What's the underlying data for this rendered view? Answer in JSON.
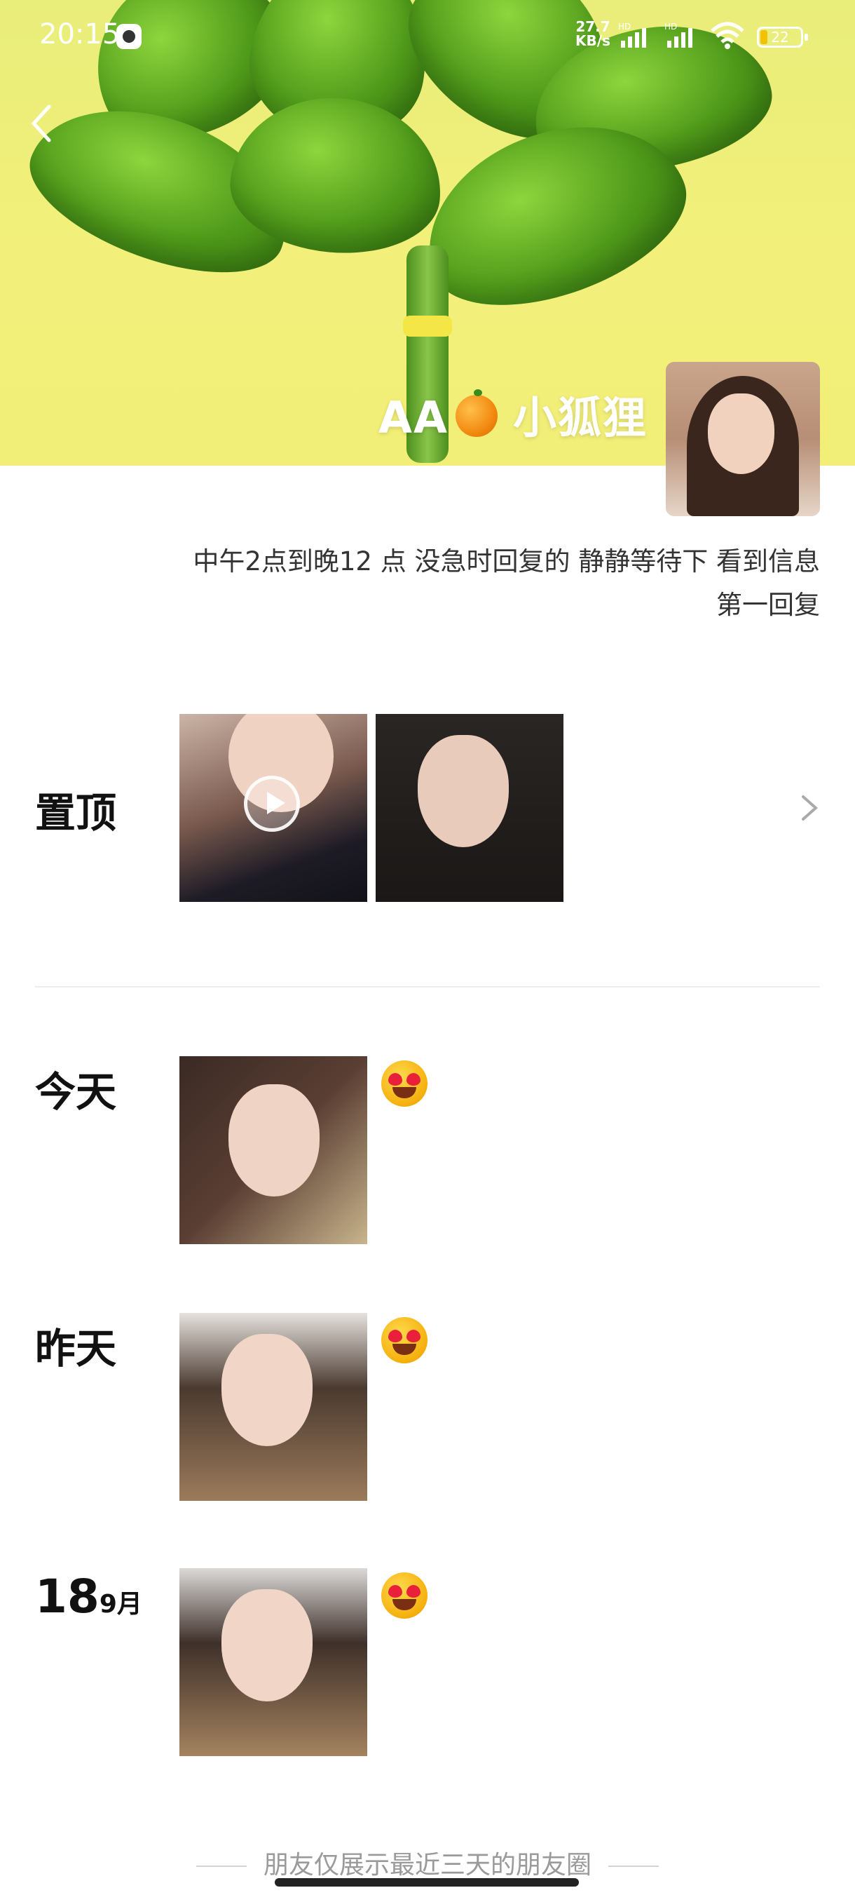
{
  "status_bar": {
    "time": "20:15",
    "net_speed": "27.7\nKB/s",
    "sim1": "HD",
    "sim2": "HD",
    "battery": "22"
  },
  "profile": {
    "nickname_left": "AA",
    "nickname_right": "小狐狸",
    "signature": "中午2点到晚12 点 没急时回复的 静静等待下 看到信息第一回复"
  },
  "sections": {
    "pinned_label": "置顶",
    "today_label": "今天",
    "yesterday_label": "昨天",
    "date_day": "18",
    "date_month": "9月"
  },
  "footer": {
    "note": "朋友仅展示最近三天的朋友圈"
  },
  "icons": {
    "back": "chevron-left-icon",
    "more": "chevron-right-icon",
    "play": "play-icon",
    "emoji": "heart-eyes-emoji"
  },
  "colors": {
    "cover_yellow": "#f2f07a",
    "leaf_green": "#4f9a1a",
    "footer_text": "#9a9a9a"
  }
}
